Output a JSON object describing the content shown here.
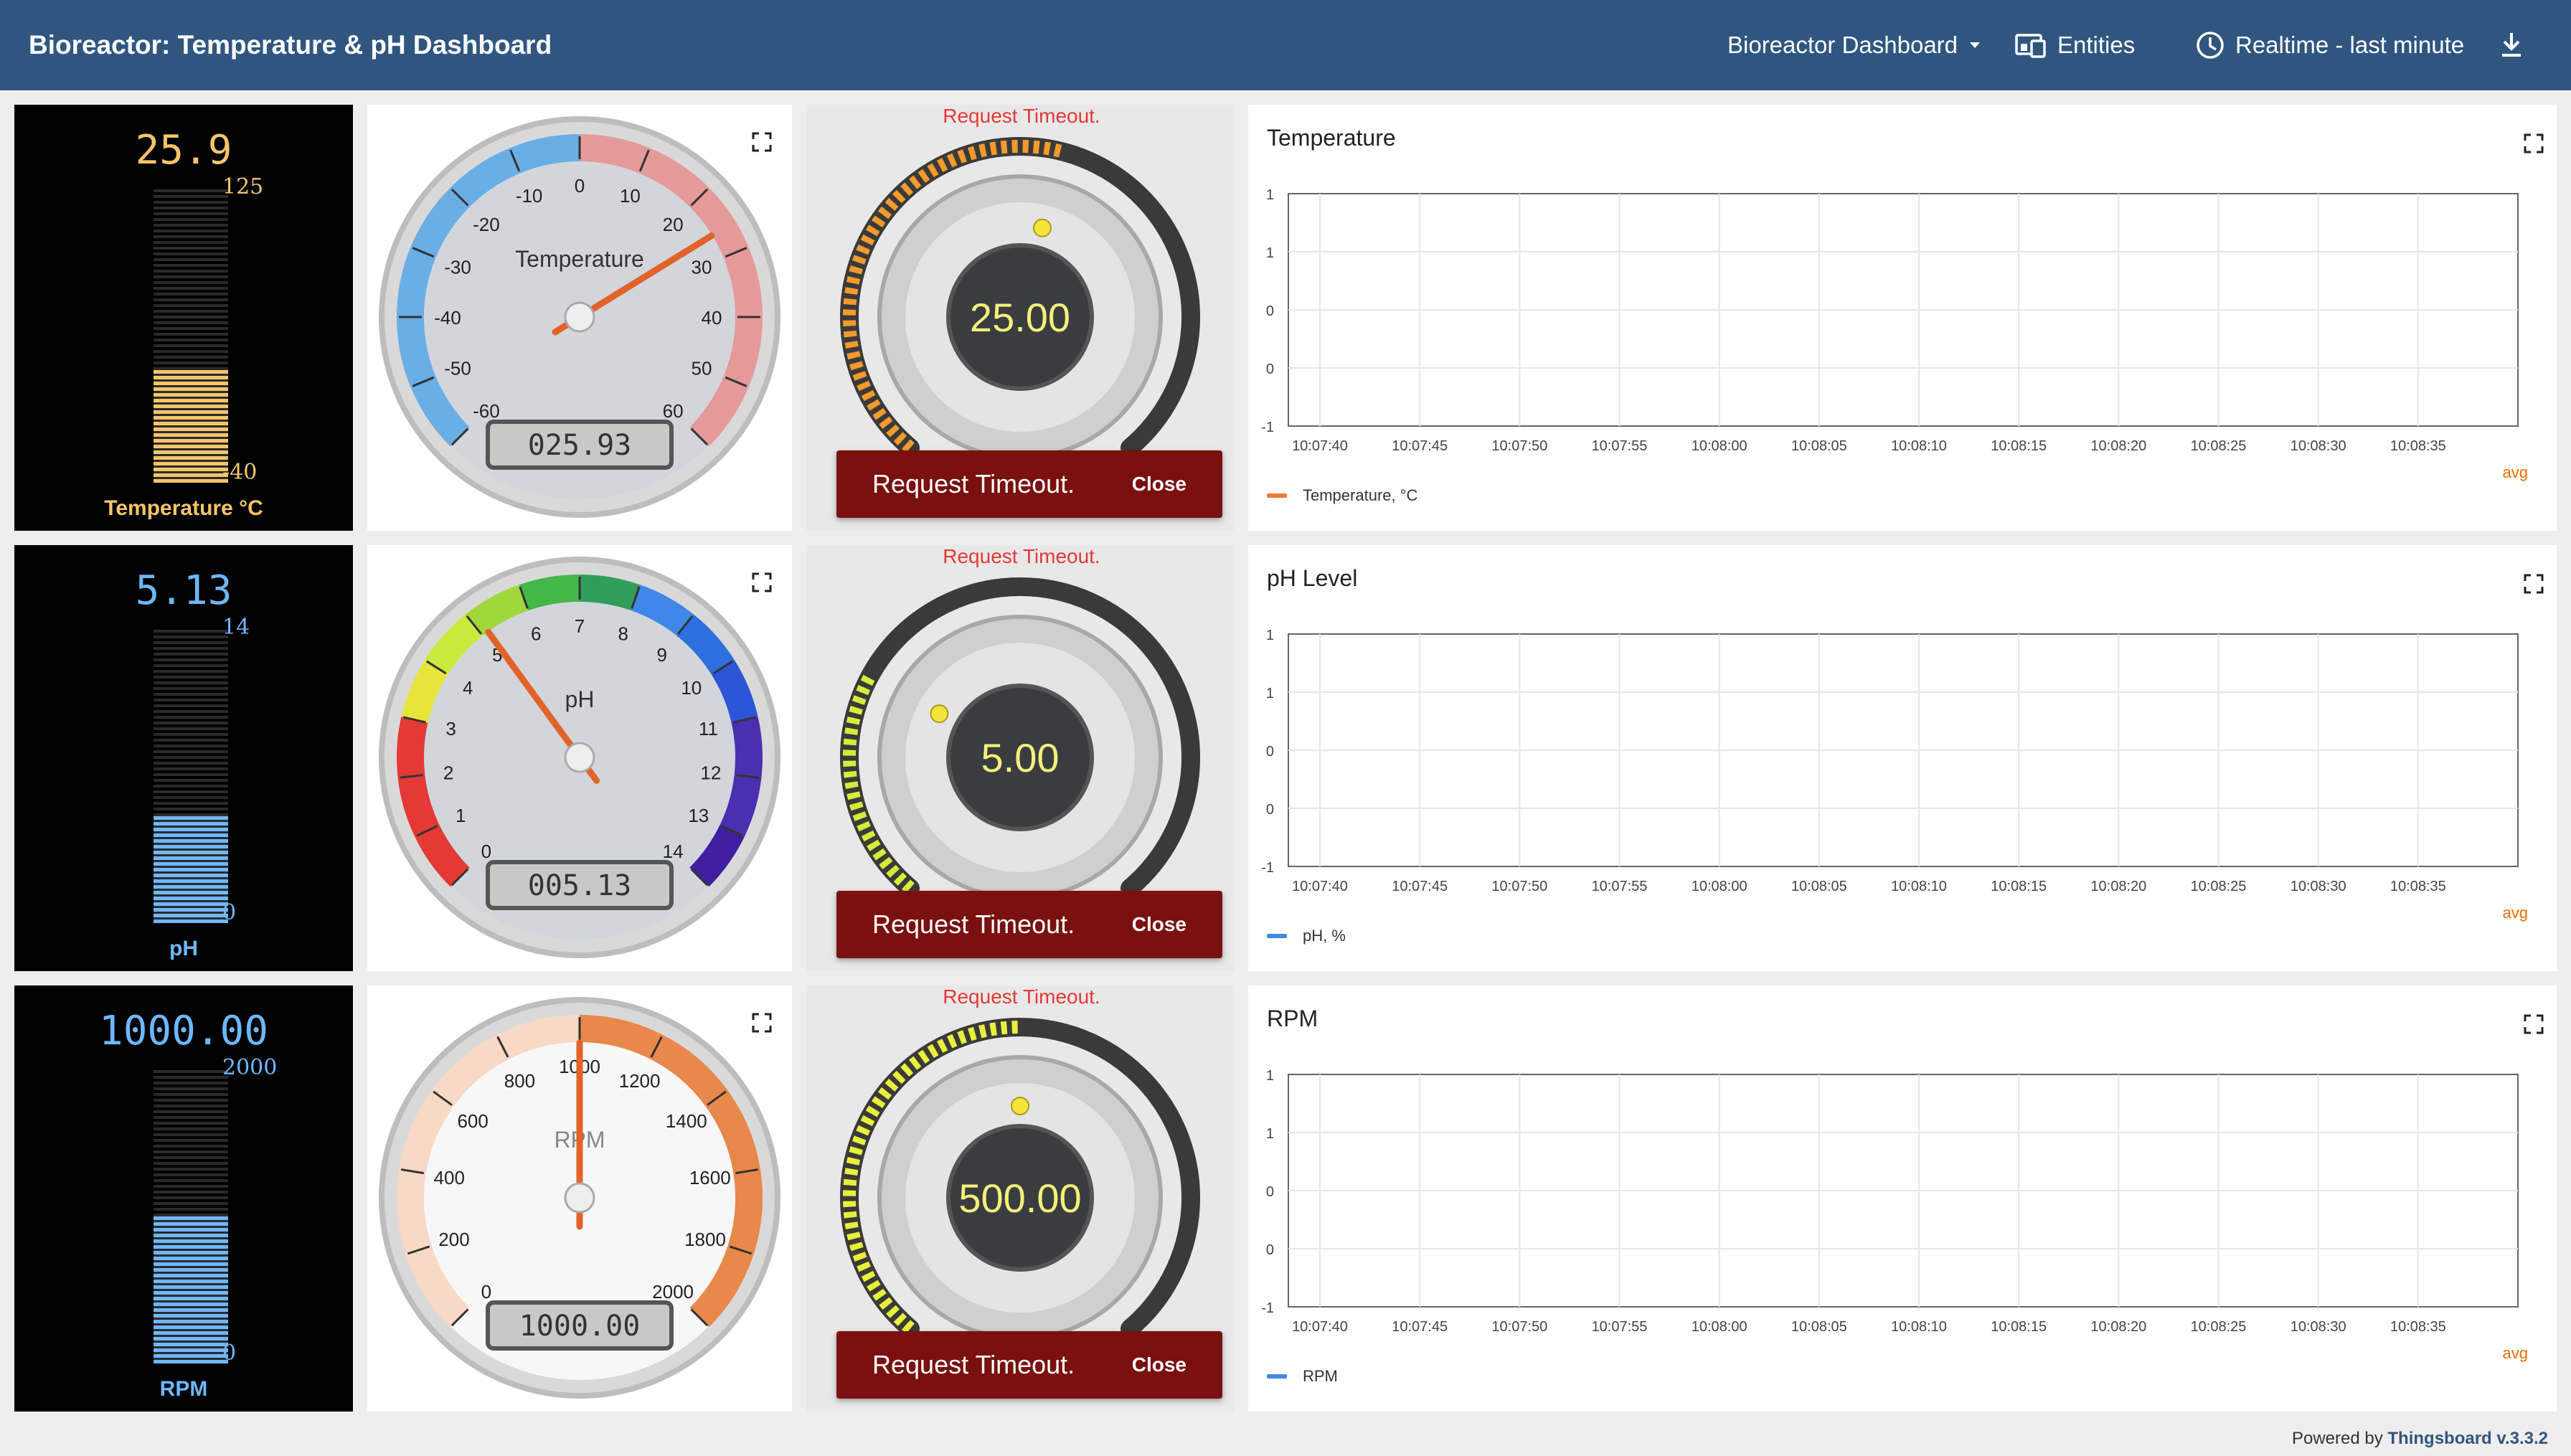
{
  "header": {
    "title": "Bioreactor: Temperature & pH Dashboard",
    "dashboard_select": "Bioreactor Dashboard",
    "entities_label": "Entities",
    "timewindow_label": "Realtime - last minute"
  },
  "rows": [
    {
      "thermo": {
        "value": "25.9",
        "max": "125",
        "min": "-40",
        "label": "Temperature °C",
        "fill_fraction": 0.39,
        "color": "#f5c56a"
      },
      "gauge": {
        "title": "Temperature",
        "lcd": "025.93",
        "ticks": [
          "-60",
          "-50",
          "-40",
          "-30",
          "-20",
          "-10",
          "0",
          "10",
          "20",
          "30",
          "40",
          "50",
          "60"
        ],
        "needle_value": 25.93
      },
      "knob": {
        "timeout_label": "Request Timeout.",
        "value": "25.00",
        "toast": "Request Timeout.",
        "close": "Close",
        "fill_fraction": 0.55,
        "color": "#f29a2e"
      },
      "chart": {
        "title": "Temperature",
        "legend": "Temperature, °C",
        "legend_color": "#ef7b2e",
        "agg": "avg"
      }
    },
    {
      "thermo": {
        "value": "5.13",
        "max": "14",
        "min": "0",
        "label": "pH",
        "fill_fraction": 0.37,
        "color": "#6fb7ff"
      },
      "gauge": {
        "title": "pH",
        "lcd": "005.13",
        "ticks": [
          "0",
          "1",
          "2",
          "3",
          "4",
          "5",
          "6",
          "7",
          "8",
          "9",
          "10",
          "11",
          "12",
          "13",
          "14"
        ],
        "needle_value": 5.13
      },
      "knob": {
        "timeout_label": "Request Timeout.",
        "value": "5.00",
        "toast": "Request Timeout.",
        "close": "Close",
        "fill_fraction": 0.28,
        "color": "#d6ec3a"
      },
      "chart": {
        "title": "pH Level",
        "legend": "pH, %",
        "legend_color": "#3f87e8",
        "agg": "avg"
      }
    },
    {
      "thermo": {
        "value": "1000.00",
        "max": "2000",
        "min": "0",
        "label": "RPM",
        "fill_fraction": 0.5,
        "color": "#6fb7ff"
      },
      "gauge": {
        "title": "RPM",
        "lcd": "1000.00",
        "ticks": [
          "0",
          "200",
          "400",
          "600",
          "800",
          "1000",
          "1200",
          "1400",
          "1600",
          "1800",
          "2000"
        ],
        "needle_value": 1000
      },
      "knob": {
        "timeout_label": "Request Timeout.",
        "value": "500.00",
        "toast": "Request Timeout.",
        "close": "Close",
        "fill_fraction": 0.5,
        "color": "#e9ef3a"
      },
      "chart": {
        "title": "RPM",
        "legend": "RPM",
        "legend_color": "#3f87e8",
        "agg": "avg"
      }
    }
  ],
  "chart_data": [
    {
      "type": "line",
      "title": "Temperature",
      "x": [
        "10:07:40",
        "10:07:45",
        "10:07:50",
        "10:07:55",
        "10:08:00",
        "10:08:05",
        "10:08:10",
        "10:08:15",
        "10:08:20",
        "10:08:25",
        "10:08:30",
        "10:08:35"
      ],
      "y_ticks": [
        "1",
        "1",
        "0",
        "0",
        "-1"
      ],
      "series": [
        {
          "name": "Temperature, °C",
          "values": []
        }
      ]
    },
    {
      "type": "line",
      "title": "pH Level",
      "x": [
        "10:07:40",
        "10:07:45",
        "10:07:50",
        "10:07:55",
        "10:08:00",
        "10:08:05",
        "10:08:10",
        "10:08:15",
        "10:08:20",
        "10:08:25",
        "10:08:30",
        "10:08:35"
      ],
      "y_ticks": [
        "1",
        "1",
        "0",
        "0",
        "-1"
      ],
      "series": [
        {
          "name": "pH, %",
          "values": []
        }
      ]
    },
    {
      "type": "line",
      "title": "RPM",
      "x": [
        "10:07:40",
        "10:07:45",
        "10:07:50",
        "10:07:55",
        "10:08:00",
        "10:08:05",
        "10:08:10",
        "10:08:15",
        "10:08:20",
        "10:08:25",
        "10:08:30",
        "10:08:35"
      ],
      "y_ticks": [
        "1",
        "1",
        "0",
        "0",
        "-1"
      ],
      "series": [
        {
          "name": "RPM",
          "values": []
        }
      ]
    }
  ],
  "footer": {
    "prefix": "Powered by",
    "brand": "Thingsboard v.3.3.2"
  }
}
